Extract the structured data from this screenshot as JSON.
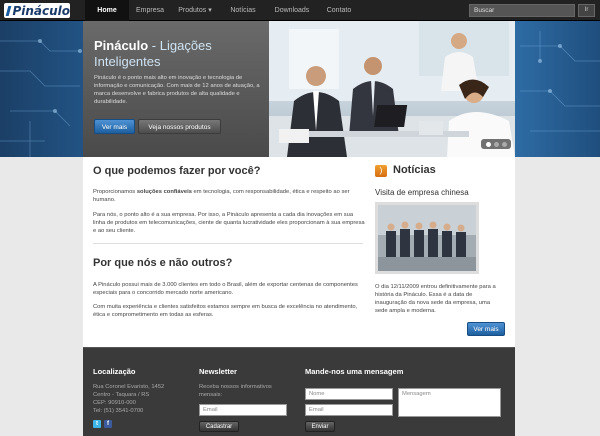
{
  "brand": {
    "logo_text": "Pináculo"
  },
  "nav": {
    "items": [
      "Home",
      "Empresa",
      "Produtos",
      "Notícias",
      "Downloads",
      "Contato"
    ],
    "dropdown_indicator": "▾",
    "search_placeholder": "Buscar",
    "search_button": "Ir"
  },
  "hero": {
    "title_brand": "Pináculo",
    "title_rest": " - Ligações Inteligentes",
    "text": "Pináculo é o ponto mais alto em inovação e tecnologia de informação e comunicação. Com mais de 12 anos de atuação, a marca desenvolve e fabrica produtos de alta qualidade e durabilidade.",
    "primary_button": "Ver mais",
    "secondary_button": "Veja nossos produtos",
    "slide_count": 3,
    "active_slide": 1
  },
  "what_we_do": {
    "heading": "O que podemos fazer por você?",
    "p1_start": "Proporcionamos ",
    "p1_bold": "soluções confiáveis",
    "p1_end": " em tecnologia, com responsabilidade, ética e respeito ao ser humano.",
    "p2": "Para nós, o ponto alto é a sua empresa. Por isso, a Pináculo apresenta a cada dia inovações em sua linha de produtos em telecomunicações, ciente de quanta lucratividade eles proporcionam à sua empresa e ao seu cliente."
  },
  "why_us": {
    "heading": "Por que nós e não outros?",
    "p1": "A Pináculo possui mais de 3.000 clientes em todo o Brasil, além de exportar centenas de componentes especiais para o concorrido mercado norte americano.",
    "p2": "Com muita experiência e clientes satisfeitos estamos sempre em busca de excelência no atendimento, ética e comprometimento em todas as esferas."
  },
  "news": {
    "heading": "Notícias",
    "icon": "rss-icon",
    "headline": "Visita de empresa chinesa",
    "body": "O dia 12/11/2009 entrou definitivamente para a história da Pináculo. Essa é a data de inauguração da nova sede da empresa, uma sede ampla e moderna.",
    "button": "Ver mais"
  },
  "footer": {
    "location": {
      "heading": "Localização",
      "address1": "Rua Coronel Evaristo, 1452",
      "address2": "Centro - Taquara / RS",
      "cep": "CEP: 90910-000",
      "phone": "Tel: (51) 3541-0700"
    },
    "newsletter": {
      "heading": "Newsletter",
      "text": "Receba nossos informativos mensais:",
      "email_placeholder": "Email",
      "button": "Cadastrar"
    },
    "message": {
      "heading": "Mande-nos uma mensagem",
      "name_placeholder": "Nome",
      "email_placeholder": "Email",
      "message_placeholder": "Mensagem",
      "button": "Enviar"
    },
    "social": [
      "twitter-icon",
      "facebook-icon"
    ]
  },
  "colors": {
    "accent_blue": "#1d5f9f",
    "nav_bg": "#222222",
    "footer_bg": "#3a3a3a",
    "rss_orange": "#e07e1a"
  }
}
